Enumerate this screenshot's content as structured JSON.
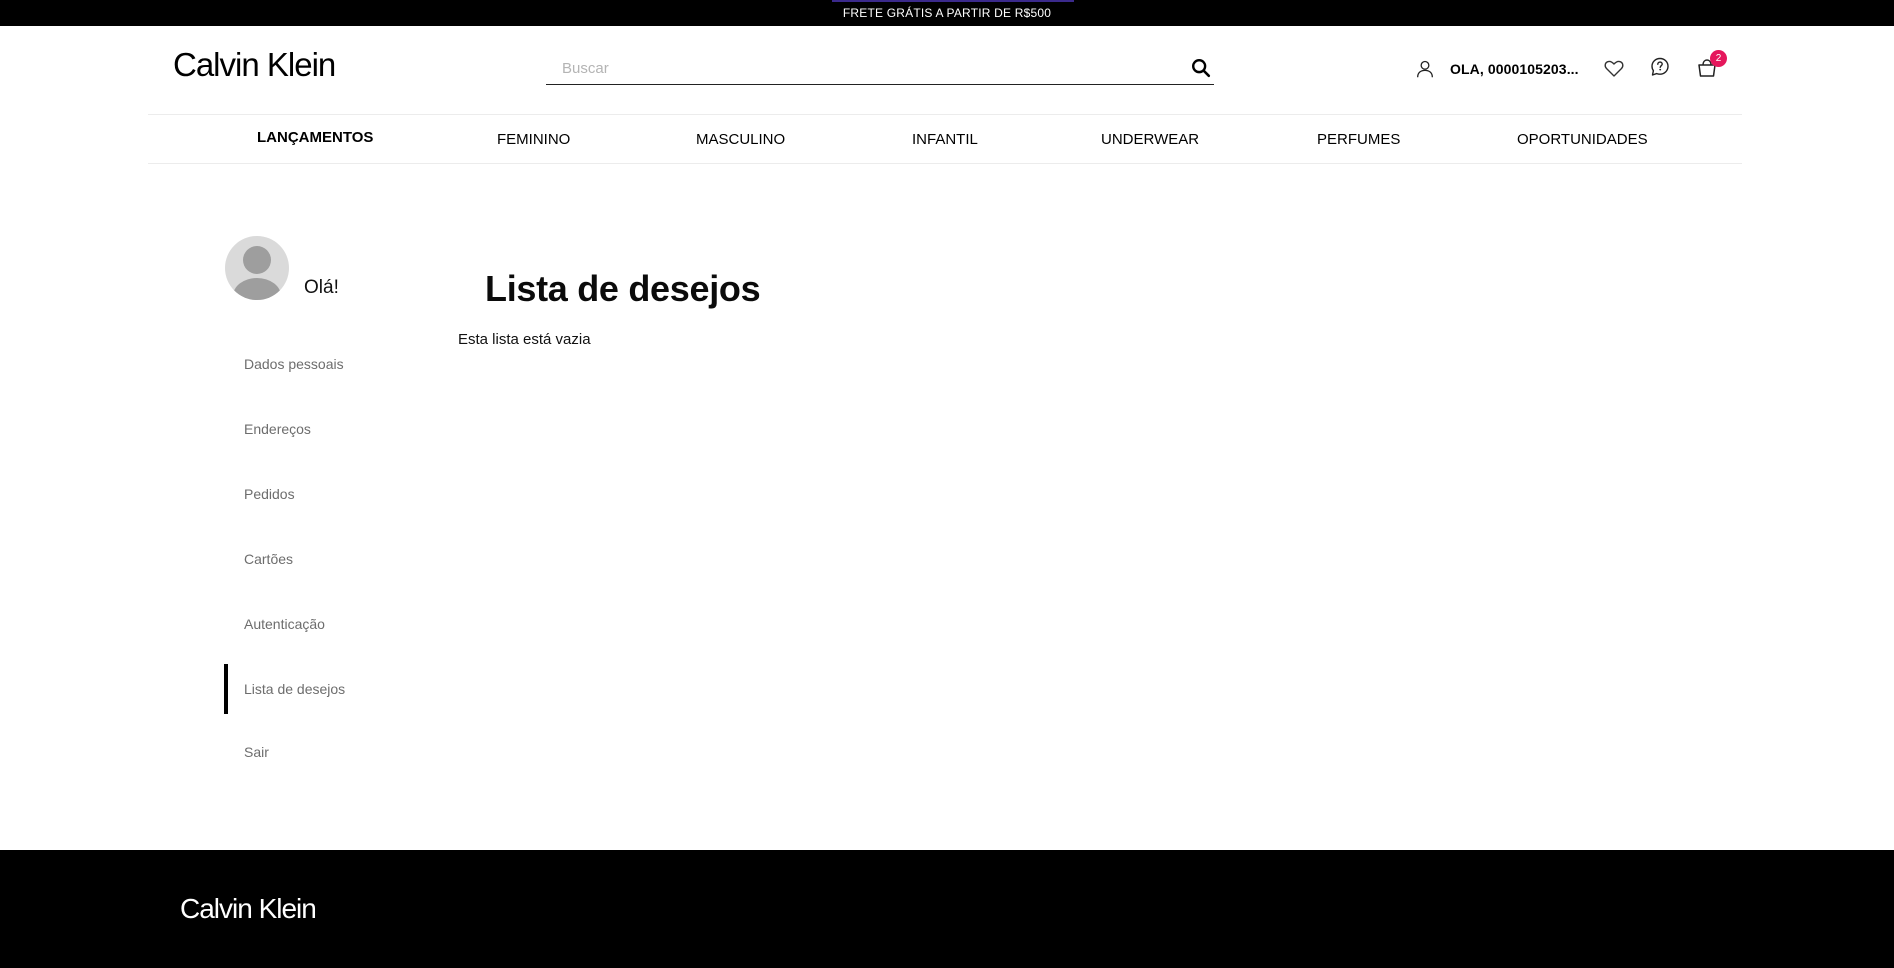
{
  "promo": {
    "text": "FRETE GRÁTIS A PARTIR DE R$500"
  },
  "header": {
    "logo": "Calvin Klein",
    "search_placeholder": "Buscar",
    "search_value": "",
    "user_greeting": "OLA, 0000105203...",
    "cart_count": "2",
    "icons": [
      "search-icon",
      "user-icon",
      "heart-icon",
      "help-icon",
      "cart-icon"
    ]
  },
  "nav": {
    "items": [
      "LANÇAMENTOS",
      "FEMININO",
      "MASCULINO",
      "INFANTIL",
      "UNDERWEAR",
      "PERFUMES",
      "OPORTUNIDADES"
    ]
  },
  "sidebar": {
    "hello": "Olá!",
    "items": [
      "Dados pessoais",
      "Endereços",
      "Pedidos",
      "Cartões",
      "Autenticação",
      "Lista de desejos",
      "Sair"
    ],
    "active": "Lista de desejos"
  },
  "main": {
    "title": "Lista de desejos",
    "empty_message": "Esta lista está vazia"
  },
  "footer": {
    "logo": "Calvin Klein"
  },
  "colors": {
    "badge": "#e5175c",
    "bars": "#000000",
    "menu_text": "#6d6d6d"
  }
}
